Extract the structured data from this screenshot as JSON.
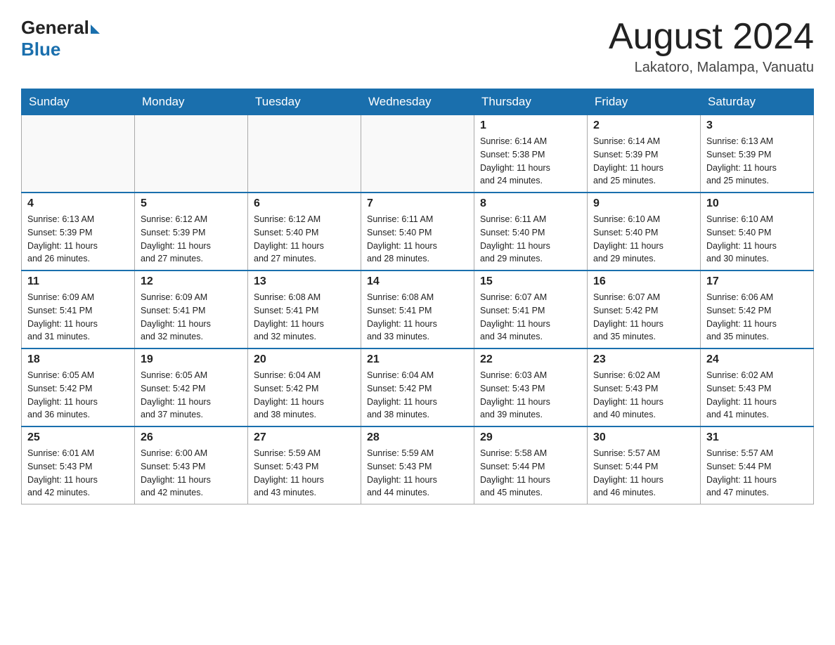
{
  "header": {
    "logo": {
      "general": "General",
      "blue": "Blue"
    },
    "month_year": "August 2024",
    "location": "Lakatoro, Malampa, Vanuatu"
  },
  "weekdays": [
    "Sunday",
    "Monday",
    "Tuesday",
    "Wednesday",
    "Thursday",
    "Friday",
    "Saturday"
  ],
  "weeks": [
    {
      "days": [
        {
          "num": "",
          "info": ""
        },
        {
          "num": "",
          "info": ""
        },
        {
          "num": "",
          "info": ""
        },
        {
          "num": "",
          "info": ""
        },
        {
          "num": "1",
          "info": "Sunrise: 6:14 AM\nSunset: 5:38 PM\nDaylight: 11 hours\nand 24 minutes."
        },
        {
          "num": "2",
          "info": "Sunrise: 6:14 AM\nSunset: 5:39 PM\nDaylight: 11 hours\nand 25 minutes."
        },
        {
          "num": "3",
          "info": "Sunrise: 6:13 AM\nSunset: 5:39 PM\nDaylight: 11 hours\nand 25 minutes."
        }
      ]
    },
    {
      "days": [
        {
          "num": "4",
          "info": "Sunrise: 6:13 AM\nSunset: 5:39 PM\nDaylight: 11 hours\nand 26 minutes."
        },
        {
          "num": "5",
          "info": "Sunrise: 6:12 AM\nSunset: 5:39 PM\nDaylight: 11 hours\nand 27 minutes."
        },
        {
          "num": "6",
          "info": "Sunrise: 6:12 AM\nSunset: 5:40 PM\nDaylight: 11 hours\nand 27 minutes."
        },
        {
          "num": "7",
          "info": "Sunrise: 6:11 AM\nSunset: 5:40 PM\nDaylight: 11 hours\nand 28 minutes."
        },
        {
          "num": "8",
          "info": "Sunrise: 6:11 AM\nSunset: 5:40 PM\nDaylight: 11 hours\nand 29 minutes."
        },
        {
          "num": "9",
          "info": "Sunrise: 6:10 AM\nSunset: 5:40 PM\nDaylight: 11 hours\nand 29 minutes."
        },
        {
          "num": "10",
          "info": "Sunrise: 6:10 AM\nSunset: 5:40 PM\nDaylight: 11 hours\nand 30 minutes."
        }
      ]
    },
    {
      "days": [
        {
          "num": "11",
          "info": "Sunrise: 6:09 AM\nSunset: 5:41 PM\nDaylight: 11 hours\nand 31 minutes."
        },
        {
          "num": "12",
          "info": "Sunrise: 6:09 AM\nSunset: 5:41 PM\nDaylight: 11 hours\nand 32 minutes."
        },
        {
          "num": "13",
          "info": "Sunrise: 6:08 AM\nSunset: 5:41 PM\nDaylight: 11 hours\nand 32 minutes."
        },
        {
          "num": "14",
          "info": "Sunrise: 6:08 AM\nSunset: 5:41 PM\nDaylight: 11 hours\nand 33 minutes."
        },
        {
          "num": "15",
          "info": "Sunrise: 6:07 AM\nSunset: 5:41 PM\nDaylight: 11 hours\nand 34 minutes."
        },
        {
          "num": "16",
          "info": "Sunrise: 6:07 AM\nSunset: 5:42 PM\nDaylight: 11 hours\nand 35 minutes."
        },
        {
          "num": "17",
          "info": "Sunrise: 6:06 AM\nSunset: 5:42 PM\nDaylight: 11 hours\nand 35 minutes."
        }
      ]
    },
    {
      "days": [
        {
          "num": "18",
          "info": "Sunrise: 6:05 AM\nSunset: 5:42 PM\nDaylight: 11 hours\nand 36 minutes."
        },
        {
          "num": "19",
          "info": "Sunrise: 6:05 AM\nSunset: 5:42 PM\nDaylight: 11 hours\nand 37 minutes."
        },
        {
          "num": "20",
          "info": "Sunrise: 6:04 AM\nSunset: 5:42 PM\nDaylight: 11 hours\nand 38 minutes."
        },
        {
          "num": "21",
          "info": "Sunrise: 6:04 AM\nSunset: 5:42 PM\nDaylight: 11 hours\nand 38 minutes."
        },
        {
          "num": "22",
          "info": "Sunrise: 6:03 AM\nSunset: 5:43 PM\nDaylight: 11 hours\nand 39 minutes."
        },
        {
          "num": "23",
          "info": "Sunrise: 6:02 AM\nSunset: 5:43 PM\nDaylight: 11 hours\nand 40 minutes."
        },
        {
          "num": "24",
          "info": "Sunrise: 6:02 AM\nSunset: 5:43 PM\nDaylight: 11 hours\nand 41 minutes."
        }
      ]
    },
    {
      "days": [
        {
          "num": "25",
          "info": "Sunrise: 6:01 AM\nSunset: 5:43 PM\nDaylight: 11 hours\nand 42 minutes."
        },
        {
          "num": "26",
          "info": "Sunrise: 6:00 AM\nSunset: 5:43 PM\nDaylight: 11 hours\nand 42 minutes."
        },
        {
          "num": "27",
          "info": "Sunrise: 5:59 AM\nSunset: 5:43 PM\nDaylight: 11 hours\nand 43 minutes."
        },
        {
          "num": "28",
          "info": "Sunrise: 5:59 AM\nSunset: 5:43 PM\nDaylight: 11 hours\nand 44 minutes."
        },
        {
          "num": "29",
          "info": "Sunrise: 5:58 AM\nSunset: 5:44 PM\nDaylight: 11 hours\nand 45 minutes."
        },
        {
          "num": "30",
          "info": "Sunrise: 5:57 AM\nSunset: 5:44 PM\nDaylight: 11 hours\nand 46 minutes."
        },
        {
          "num": "31",
          "info": "Sunrise: 5:57 AM\nSunset: 5:44 PM\nDaylight: 11 hours\nand 47 minutes."
        }
      ]
    }
  ]
}
